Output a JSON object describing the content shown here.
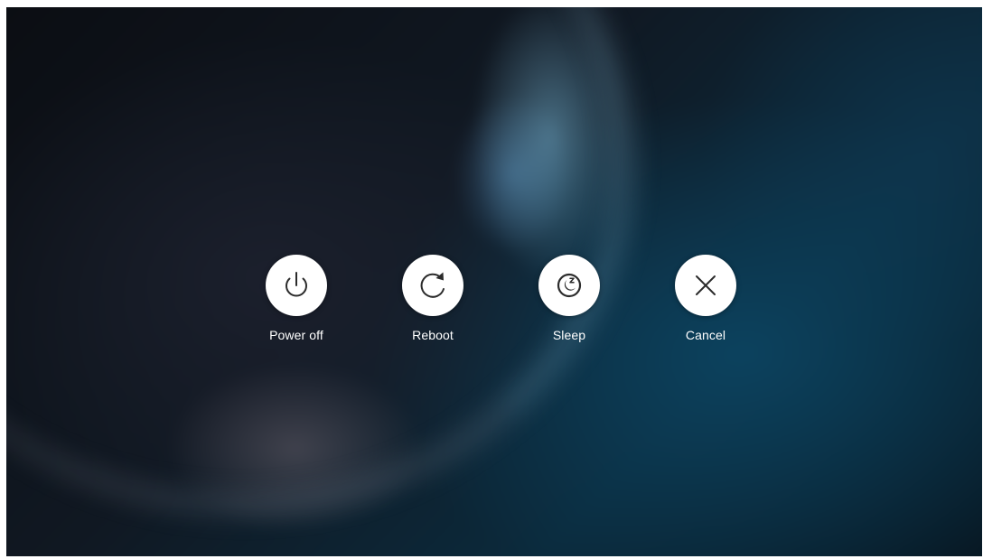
{
  "power_menu": {
    "options": [
      {
        "label": "Power off",
        "icon": "power-icon"
      },
      {
        "label": "Reboot",
        "icon": "reboot-icon"
      },
      {
        "label": "Sleep",
        "icon": "sleep-icon"
      },
      {
        "label": "Cancel",
        "icon": "close-icon"
      }
    ]
  },
  "colors": {
    "button_background": "#ffffff",
    "icon": "#2b2b2b",
    "label": "#ffffff"
  }
}
